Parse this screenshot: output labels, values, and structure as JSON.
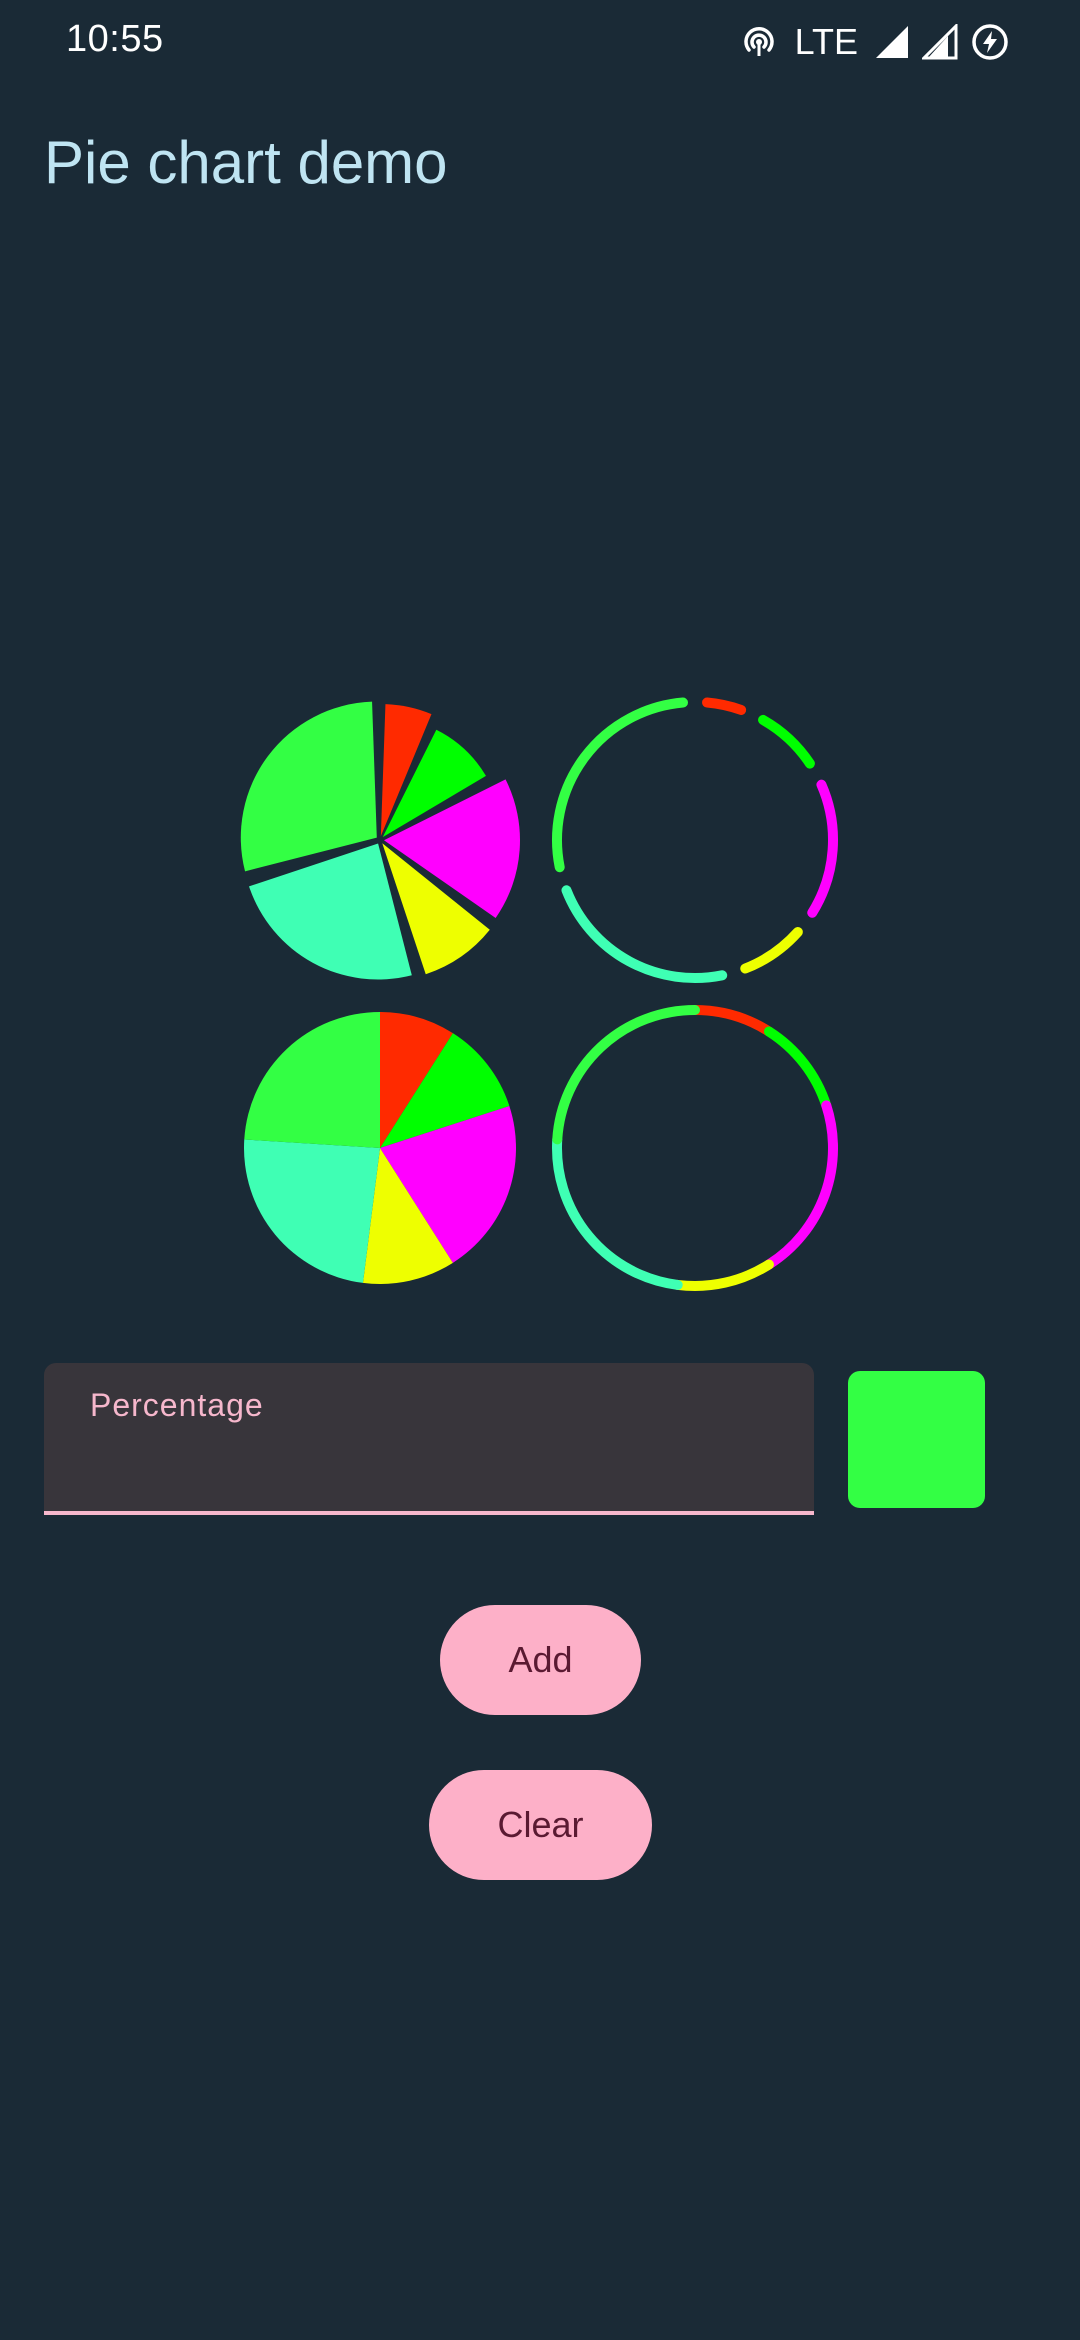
{
  "status_bar": {
    "time": "10:55",
    "network": "LTE",
    "icons": [
      "hotspot-icon",
      "signal-icon",
      "signal-icon",
      "battery-saver-icon"
    ]
  },
  "app": {
    "title": "Pie chart demo"
  },
  "form": {
    "percentage_label": "Percentage",
    "percentage_value": "",
    "selected_color": "#33ff44",
    "add_label": "Add",
    "clear_label": "Clear"
  },
  "colors": {
    "background": "#1a2a36",
    "title": "#bfe4f2",
    "accent_pink": "#fdb0c8"
  },
  "chart_data": [
    {
      "type": "pie",
      "style": "exploded-pie",
      "slices": [
        {
          "value": 6,
          "color": "#ff2a00"
        },
        {
          "value": 9,
          "color": "#00ff00"
        },
        {
          "value": 16,
          "color": "#ff00ff"
        },
        {
          "value": 9,
          "color": "#eeff00"
        },
        {
          "value": 22,
          "color": "#3fffb4"
        },
        {
          "value": 26,
          "color": "#33ff44"
        }
      ]
    },
    {
      "type": "pie",
      "style": "ring-gapped",
      "slices": [
        {
          "value": 6,
          "color": "#ff2a00"
        },
        {
          "value": 9,
          "color": "#00ff00"
        },
        {
          "value": 16,
          "color": "#ff00ff"
        },
        {
          "value": 9,
          "color": "#eeff00"
        },
        {
          "value": 22,
          "color": "#3fffb4"
        },
        {
          "value": 26,
          "color": "#33ff44"
        }
      ]
    },
    {
      "type": "pie",
      "style": "pie",
      "slices": [
        {
          "value": 9,
          "color": "#ff2a00"
        },
        {
          "value": 11,
          "color": "#00ff00"
        },
        {
          "value": 21,
          "color": "#ff00ff"
        },
        {
          "value": 11,
          "color": "#eeff00"
        },
        {
          "value": 24,
          "color": "#3fffb4"
        },
        {
          "value": 24,
          "color": "#33ff44"
        }
      ]
    },
    {
      "type": "pie",
      "style": "ring",
      "slices": [
        {
          "value": 9,
          "color": "#ff2a00"
        },
        {
          "value": 11,
          "color": "#00ff00"
        },
        {
          "value": 21,
          "color": "#ff00ff"
        },
        {
          "value": 11,
          "color": "#eeff00"
        },
        {
          "value": 24,
          "color": "#3fffb4"
        },
        {
          "value": 24,
          "color": "#33ff44"
        }
      ]
    }
  ]
}
